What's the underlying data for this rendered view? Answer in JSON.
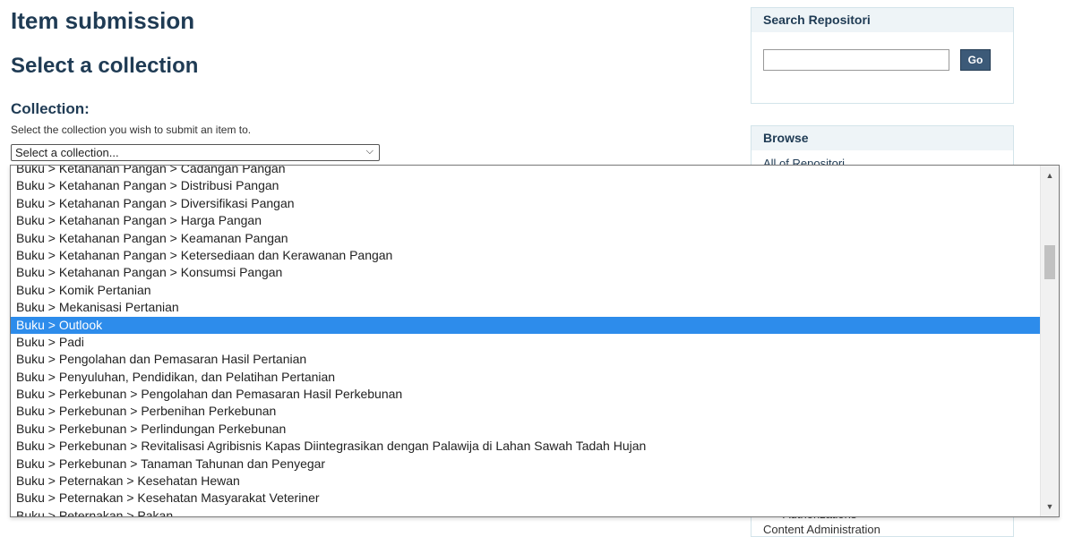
{
  "page": {
    "title": "Item submission",
    "subtitle": "Select a collection",
    "field_label": "Collection:",
    "help_text": "Select the collection you wish to submit an item to.",
    "select_value": "Select a collection..."
  },
  "sidebar": {
    "search_title": "Search Repositori",
    "search_value": "",
    "go_label": "Go",
    "browse_title": "Browse",
    "browse_first_link": "All of Repositori",
    "peek_line_1": "Authorizations",
    "peek_line_2": "Content Administration"
  },
  "dropdown": {
    "selected_index": 9,
    "options": [
      "Buku > Ketahanan Pangan > Cadangan Pangan",
      "Buku > Ketahanan Pangan > Distribusi Pangan",
      "Buku > Ketahanan Pangan > Diversifikasi Pangan",
      "Buku > Ketahanan Pangan > Harga Pangan",
      "Buku > Ketahanan Pangan > Keamanan Pangan",
      "Buku > Ketahanan Pangan > Ketersediaan dan Kerawanan Pangan",
      "Buku > Ketahanan Pangan > Konsumsi Pangan",
      "Buku > Komik Pertanian",
      "Buku > Mekanisasi Pertanian",
      "Buku > Outlook",
      "Buku > Padi",
      "Buku > Pengolahan dan Pemasaran Hasil Pertanian",
      "Buku > Penyuluhan, Pendidikan, dan Pelatihan Pertanian",
      "Buku > Perkebunan > Pengolahan dan Pemasaran Hasil Perkebunan",
      "Buku > Perkebunan > Perbenihan Perkebunan",
      "Buku > Perkebunan > Perlindungan Perkebunan",
      "Buku > Perkebunan > Revitalisasi Agribisnis Kapas Diintegrasikan dengan Palawija di Lahan Sawah Tadah Hujan",
      "Buku > Perkebunan > Tanaman Tahunan dan Penyegar",
      "Buku > Peternakan > Kesehatan Hewan",
      "Buku > Peternakan > Kesehatan Masyarakat Veteriner",
      "Buku > Peternakan > Pakan"
    ]
  },
  "icons": {
    "select_chevron": "chevron-down-icon",
    "scroll_up": "arrow-up-icon",
    "scroll_down": "arrow-down-icon"
  },
  "colors": {
    "heading": "#1f3b54",
    "selection": "#2d8ceb",
    "button": "#3c5a78",
    "sidebar_header": "#eef4f7"
  }
}
